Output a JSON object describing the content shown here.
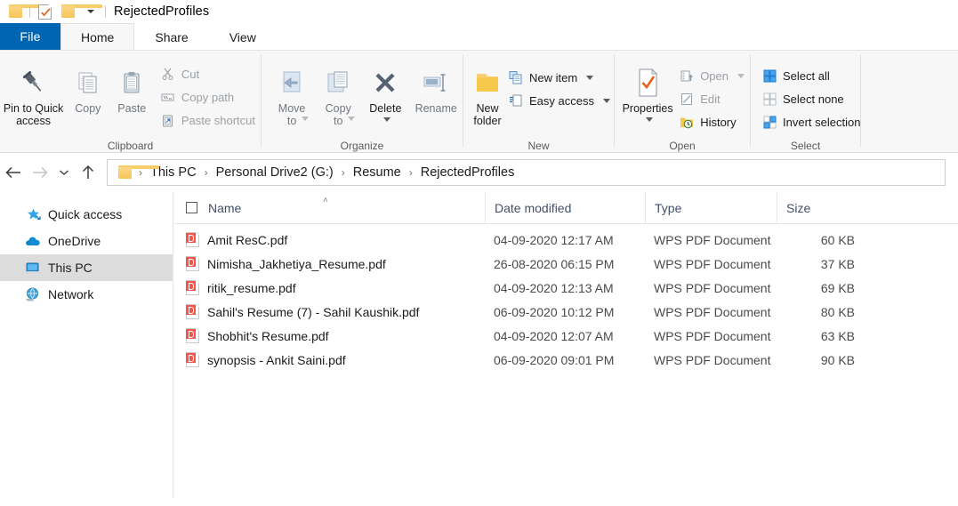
{
  "window": {
    "title": "RejectedProfiles",
    "quick_access": [
      "folder-icon",
      "properties-icon",
      "new-folder-icon",
      "customize-chevron"
    ]
  },
  "tabs": [
    {
      "label": "File",
      "active": false,
      "kind": "file"
    },
    {
      "label": "Home",
      "active": true,
      "kind": "normal"
    },
    {
      "label": "Share",
      "active": false,
      "kind": "normal"
    },
    {
      "label": "View",
      "active": false,
      "kind": "normal"
    }
  ],
  "ribbon": {
    "groups": [
      {
        "label": "Clipboard",
        "big": [
          {
            "label": "Pin to Quick\naccess",
            "icon": "pin-icon",
            "enabled": true
          },
          {
            "label": "Copy",
            "icon": "copy-icon",
            "enabled": false
          },
          {
            "label": "Paste",
            "icon": "paste-icon",
            "enabled": false
          }
        ],
        "small": [
          {
            "label": "Cut",
            "icon": "scissors-icon",
            "enabled": false
          },
          {
            "label": "Copy path",
            "icon": "copy-path-icon",
            "enabled": false
          },
          {
            "label": "Paste shortcut",
            "icon": "paste-shortcut-icon",
            "enabled": false
          }
        ]
      },
      {
        "label": "Organize",
        "big": [
          {
            "label": "Move\nto",
            "icon": "move-to-icon",
            "enabled": false,
            "caret": true
          },
          {
            "label": "Copy\nto",
            "icon": "copy-to-icon",
            "enabled": false,
            "caret": true
          },
          {
            "label": "Delete",
            "icon": "delete-icon",
            "enabled": true,
            "caret": true
          },
          {
            "label": "Rename",
            "icon": "rename-icon",
            "enabled": false
          }
        ],
        "small": []
      },
      {
        "label": "New",
        "big": [
          {
            "label": "New\nfolder",
            "icon": "new-folder-icon",
            "enabled": true
          }
        ],
        "small": [
          {
            "label": "New item",
            "icon": "new-item-icon",
            "enabled": true,
            "caret": true
          },
          {
            "label": "Easy access",
            "icon": "easy-access-icon",
            "enabled": true,
            "caret": true
          }
        ]
      },
      {
        "label": "Open",
        "big": [
          {
            "label": "Properties",
            "icon": "properties-icon",
            "enabled": true,
            "caret": true
          }
        ],
        "small": [
          {
            "label": "Open",
            "icon": "open-icon",
            "enabled": false,
            "caret": true
          },
          {
            "label": "Edit",
            "icon": "edit-icon",
            "enabled": false
          },
          {
            "label": "History",
            "icon": "history-icon",
            "enabled": true
          }
        ]
      },
      {
        "label": "Select",
        "big": [],
        "small": [
          {
            "label": "Select all",
            "icon": "select-all-icon",
            "enabled": true
          },
          {
            "label": "Select none",
            "icon": "select-none-icon",
            "enabled": true
          },
          {
            "label": "Invert selection",
            "icon": "invert-selection-icon",
            "enabled": true
          }
        ]
      }
    ]
  },
  "address": {
    "back_icon": "arrow-left-icon",
    "forward_icon": "arrow-right-icon",
    "recent_icon": "chevron-down-icon",
    "up_icon": "arrow-up-icon",
    "breadcrumb": [
      "This PC",
      "Personal Drive2 (G:)",
      "Resume",
      "RejectedProfiles"
    ],
    "separator": "›"
  },
  "sidebar": {
    "items": [
      {
        "label": "Quick access",
        "icon": "star-pin-icon",
        "selected": false
      },
      {
        "label": "OneDrive",
        "icon": "cloud-icon",
        "selected": false
      },
      {
        "label": "This PC",
        "icon": "computer-icon",
        "selected": true
      },
      {
        "label": "Network",
        "icon": "network-icon",
        "selected": false
      }
    ]
  },
  "file_list": {
    "columns": [
      {
        "key": "name",
        "label": "Name",
        "sorted": "asc"
      },
      {
        "key": "date",
        "label": "Date modified"
      },
      {
        "key": "type",
        "label": "Type"
      },
      {
        "key": "size",
        "label": "Size"
      }
    ],
    "sort_caret": "˄",
    "rows": [
      {
        "name": "Amit ResC.pdf",
        "date": "04-09-2020 12:17 AM",
        "type": "WPS PDF Document",
        "size": "60 KB",
        "icon": "pdf-file-icon"
      },
      {
        "name": "Nimisha_Jakhetiya_Resume.pdf",
        "date": "26-08-2020 06:15 PM",
        "type": "WPS PDF Document",
        "size": "37 KB",
        "icon": "pdf-file-icon"
      },
      {
        "name": "ritik_resume.pdf",
        "date": "04-09-2020 12:13 AM",
        "type": "WPS PDF Document",
        "size": "69 KB",
        "icon": "pdf-file-icon"
      },
      {
        "name": "Sahil's Resume (7) - Sahil Kaushik.pdf",
        "date": "06-09-2020 10:12 PM",
        "type": "WPS PDF Document",
        "size": "80 KB",
        "icon": "pdf-file-icon"
      },
      {
        "name": "Shobhit's Resume.pdf",
        "date": "04-09-2020 12:07 AM",
        "type": "WPS PDF Document",
        "size": "63 KB",
        "icon": "pdf-file-icon"
      },
      {
        "name": "synopsis - Ankit Saini.pdf",
        "date": "06-09-2020 09:01 PM",
        "type": "WPS PDF Document",
        "size": "90 KB",
        "icon": "pdf-file-icon"
      }
    ]
  },
  "colors": {
    "file_tab_blue": "#0065b3",
    "ribbon_bg": "#f7f7f7",
    "selected_nav": "#dcdcdc",
    "pdf_red": "#f4564e",
    "header_text": "#41506b",
    "accent_blue": "#1b8ee8"
  }
}
